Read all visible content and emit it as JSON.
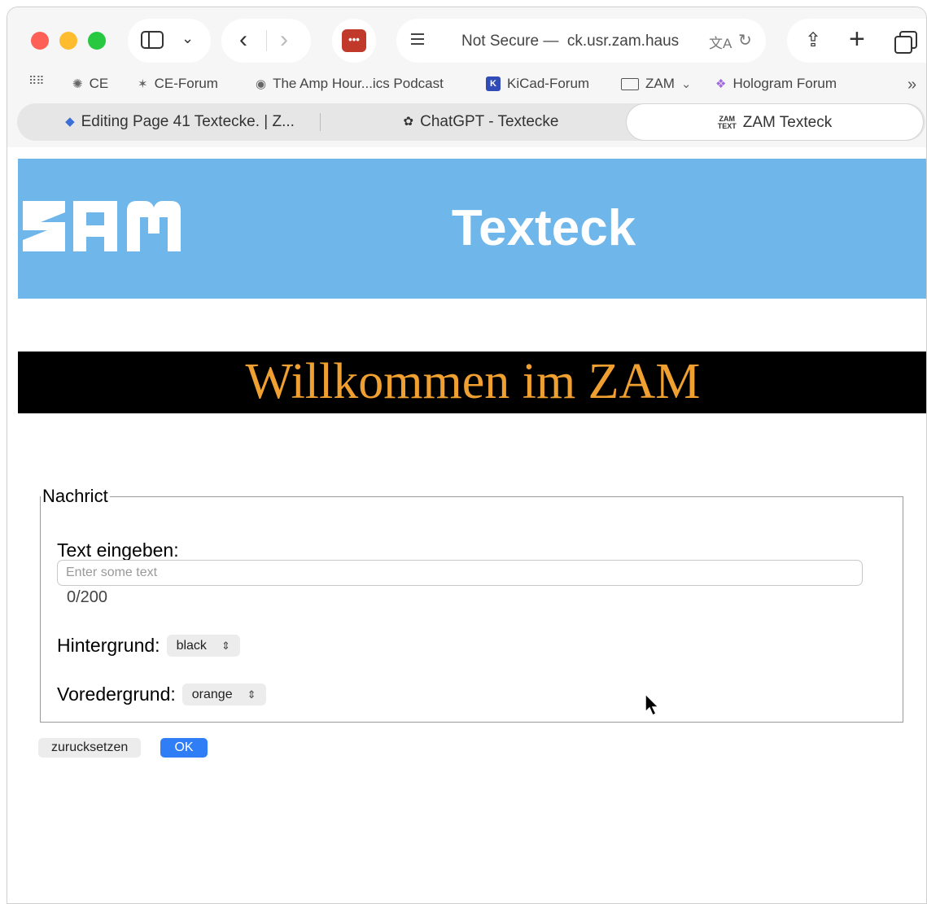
{
  "browser": {
    "address": "Not Secure —  ck.usr.zam.haus",
    "icons": {
      "sidebar": "sidebar-icon",
      "back": "chevron-left-icon",
      "forward": "chevron-right-icon",
      "extension": "password-manager-icon",
      "reader": "reader-icon",
      "translate": "translate-icon",
      "reload": "reload-icon",
      "share": "share-icon",
      "new_tab": "plus-icon",
      "tab_overview": "tab-overview-icon"
    },
    "bookmarks": [
      {
        "label": "CE"
      },
      {
        "label": "CE-Forum"
      },
      {
        "label": "The Amp Hour...ics Podcast"
      },
      {
        "label": "KiCad-Forum"
      },
      {
        "label": "ZAM"
      },
      {
        "label": "Hologram Forum"
      }
    ],
    "tabs": [
      {
        "label": "Editing Page 41 Textecke. | Z..."
      },
      {
        "label": "ChatGPT - Textecke"
      },
      {
        "label": "ZAM Texteck",
        "active": true
      }
    ]
  },
  "page": {
    "banner_title": "Texteck",
    "logo": "ZAM",
    "welcome": "Willkommen im ZAM",
    "form": {
      "legend": "Nachrict",
      "text_label": "Text eingeben:",
      "text_placeholder": "Enter some text",
      "text_value": "",
      "counter": "0/200",
      "background_label": "Hintergrund:",
      "background_value": "black",
      "foreground_label": "Voredergrund:",
      "foreground_value": "orange"
    },
    "buttons": {
      "reset": "zurucksetzen",
      "ok": "OK"
    }
  },
  "colors": {
    "banner": "#6fb7ea",
    "welcome_bg": "#000000",
    "welcome_fg": "#f0a030",
    "ok_button": "#2f7ef5"
  }
}
